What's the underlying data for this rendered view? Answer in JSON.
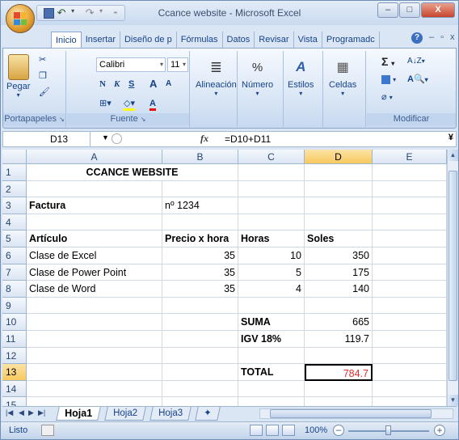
{
  "window": {
    "title": "Ccance website - Microsoft Excel",
    "minimize": "–",
    "maximize": "□",
    "close": "X"
  },
  "tabs": [
    "Inicio",
    "Insertar",
    "Diseño de p",
    "Fórmulas",
    "Datos",
    "Revisar",
    "Vista",
    "Programadc"
  ],
  "active_tab": "Inicio",
  "ribbon": {
    "clipboard": {
      "paste_label": "Pegar",
      "group_label": "Portapapeles"
    },
    "font": {
      "font_name": "Calibri",
      "font_size": "11",
      "bold": "N",
      "italic": "K",
      "underline": "S",
      "grow": "A",
      "shrink": "A",
      "font_color": "A",
      "group_label": "Fuente"
    },
    "alignment": {
      "label": "Alineación"
    },
    "number": {
      "label": "Número",
      "percent": "%"
    },
    "styles": {
      "label": "Estilos"
    },
    "cells": {
      "label": "Celdas"
    },
    "editing": {
      "sigma": "Σ",
      "sort": "A↓Z",
      "find": "A",
      "clear": "⌫",
      "group_label": "Modificar"
    }
  },
  "formula_bar": {
    "name_box": "D13",
    "fx": "fx",
    "formula": "=D10+D11"
  },
  "columns": [
    "A",
    "B",
    "C",
    "D",
    "E"
  ],
  "rows": [
    "1",
    "2",
    "3",
    "4",
    "5",
    "6",
    "7",
    "8",
    "9",
    "10",
    "11",
    "12",
    "13",
    "14",
    "15"
  ],
  "cells": {
    "A1": "CCANCE WEBSITE",
    "A3": "Factura",
    "B3": "nº 1234",
    "A5": "Artículo",
    "B5": "Precio x hora",
    "C5": "Horas",
    "D5": "Soles",
    "A6": "Clase de Excel",
    "B6": "35",
    "C6": "10",
    "D6": "350",
    "A7": "Clase de Power Point",
    "B7": "35",
    "C7": "5",
    "D7": "175",
    "A8": "Clase de Word",
    "B8": "35",
    "C8": "4",
    "D8": "140",
    "C10": "SUMA",
    "D10": "665",
    "C11": "IGV 18%",
    "D11": "119.7",
    "C13": "TOTAL",
    "D13": "784.7"
  },
  "sheets": [
    "Hoja1",
    "Hoja2",
    "Hoja3"
  ],
  "active_sheet": "Hoja1",
  "status": {
    "text": "Listo",
    "zoom": "100%"
  },
  "colors": {
    "total_value": "#e03030",
    "selected_header": "#f8c95e"
  }
}
